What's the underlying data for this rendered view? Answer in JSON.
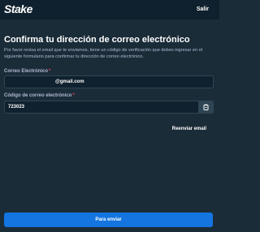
{
  "header": {
    "logo_text": "Stake",
    "exit_label": "Salir"
  },
  "page": {
    "title": "Confirma tu dirección de correo electrónico",
    "description": "Por favor revisa el email que te enviamos, tiene un código de verificación que debes ingresar en el siguiente formulario para confirmar tu dirección de correo electrónico."
  },
  "form": {
    "email_label": "Correo Electrónico",
    "email_required_mark": "*",
    "email_value_suffix": "@gmail.com",
    "code_label": "Código de correo electrónico",
    "code_required_mark": "*",
    "code_value": "723023",
    "resend_label": "Reenviar email",
    "submit_label": "Para enviar"
  },
  "colors": {
    "background": "#1a2c38",
    "header_background": "#0f212e",
    "input_background": "#0f212e",
    "primary_button": "#1475e1",
    "required_mark": "#ed4163"
  },
  "icons": {
    "paste": "paste-icon"
  }
}
